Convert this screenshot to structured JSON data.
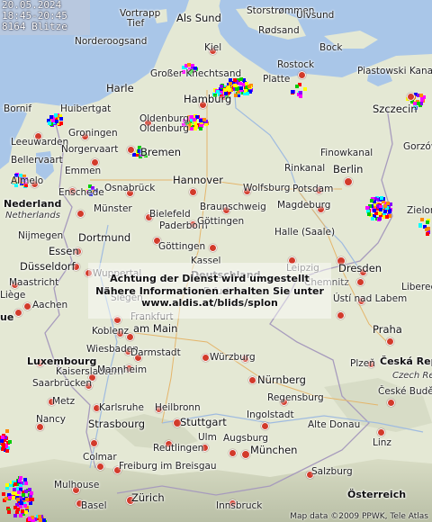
{
  "info": {
    "date": "20.05.2024",
    "time_range": "18:45-20:45",
    "count": "8164 Blitze"
  },
  "notice": {
    "line1": "Achtung der Dienst wird umgestellt",
    "line2": "Nähere Informationen erhalten Sie unter",
    "line3": "www.aldis.at/blids/splon"
  },
  "attribution": "Map data ©2009 PPWK, Tele Atlas",
  "places": {
    "vortrapp": "Vortrapp",
    "tief": "Tief",
    "als_sund": "Als Sund",
    "storstrommen": "Storstrømmen",
    "ulvsund": "Ulvsund",
    "rodsand": "Rødsand",
    "nordoogsand": "Norderoogsand",
    "kiel": "Kiel",
    "bock": "Bock",
    "rostock": "Rostock",
    "grosser_knechtsand": "Großer Knechtsand",
    "harle": "Harle",
    "hamburg": "Hamburg",
    "platte": "Platte",
    "piastowski": "Piastowski Kanał",
    "bornif": "Bornif",
    "huibertgat": "Huibertgat",
    "groningen": "Groningen",
    "oldenburg": "Oldenburg",
    "szczecin": "Szczecin",
    "leeuwarden": "Leeuwarden",
    "norgervaart": "Norgervaart",
    "bremen": "Bremen",
    "gorzow": "Gorzów Wielkopolski",
    "bellervaart": "Bellervaart",
    "emmen": "Emmen",
    "finowkanal": "Finowkanal",
    "rinkanal": "Rinkanal",
    "berlin": "Berlin",
    "almelo": "Almelo",
    "enschede": "Enschede",
    "osnabrueck": "Osnabrück",
    "hannover": "Hannover",
    "wolfsburg": "Wolfsburg",
    "potsdam": "Potsdam",
    "nederland": "Nederland",
    "netherlands": "Netherlands",
    "braunschweig": "Braunschweig",
    "magdeburg": "Magdeburg",
    "zielona": "Zielona",
    "munster": "Münster",
    "bielefeld": "Bielefeld",
    "nijmegen": "Nijmegen",
    "gottingen": "Göttingen",
    "dortmund": "Dortmund",
    "paderborn": "Paderborn",
    "halle": "Halle (Saale)",
    "essen": "Essen",
    "kassel": "Kassel",
    "leipzig": "Leipzig",
    "dresden": "Dresden",
    "dusseldorf": "Düsseldorf",
    "wuppertal": "Wuppertal",
    "deutschland": "Deutschland",
    "chemnitz": "Chemnitz",
    "maastricht": "Maastricht",
    "liberec": "Liberec",
    "liege": "Liège",
    "aachen": "Aachen",
    "siegen": "Siegen",
    "erfurt": "Erfurt",
    "usti": "Ústí nad Labem",
    "frankfurt": "Frankfurt",
    "koblenz": "Koblenz",
    "am_main": "am Main",
    "praha": "Praha",
    "wiesbaden": "Wiesbaden",
    "darmstadt": "Darmstadt",
    "wurzburg": "Würzburg",
    "luxembourg": "Luxembourg",
    "plzen": "Plzeň",
    "ceska": "Česká Rep",
    "czech": "Czech Rep",
    "kaiserslautern": "Kaiserslautern",
    "mannheim": "Mannheim",
    "saarbrucken": "Saarbrücken",
    "nurnberg": "Nürnberg",
    "metz": "Metz",
    "karlsruhe": "Karlsruhe",
    "heilbronn": "Heilbronn",
    "regensburg": "Regensburg",
    "ceske": "České Budějovice",
    "nancy": "Nancy",
    "strasbourg": "Strasbourg",
    "stuttgart": "Stuttgart",
    "ingolstadt": "Ingolstadt",
    "alte_donau": "Alte Donau",
    "reutlingen": "Reutlingen",
    "ulm": "Ulm",
    "augsburg": "Augsburg",
    "linz": "Linz",
    "munchen": "München",
    "colmar": "Colmar",
    "freiburg": "Freiburg im Breisgau",
    "mulhouse": "Mulhouse",
    "basel": "Basel",
    "salzburg": "Salzburg",
    "zurich": "Zürich",
    "osterreich": "Österreich",
    "innsbruck": "Innsbruck",
    "que": "ue"
  },
  "colors": {
    "land": "#e4e8d4",
    "sea": "#a9c6e8",
    "city_dot": "#d23a2a"
  }
}
